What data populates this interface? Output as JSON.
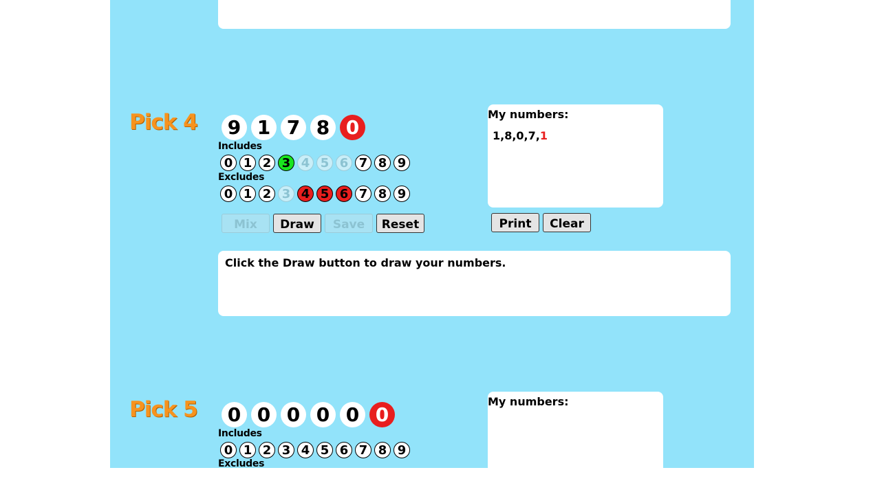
{
  "pick4": {
    "title": "Pick 4",
    "balls": [
      {
        "value": "9",
        "bonus": false
      },
      {
        "value": "1",
        "bonus": false
      },
      {
        "value": "7",
        "bonus": false
      },
      {
        "value": "8",
        "bonus": false
      },
      {
        "value": "0",
        "bonus": true
      }
    ],
    "includes_label": "Includes",
    "includes": [
      {
        "d": "0",
        "state": "normal"
      },
      {
        "d": "1",
        "state": "normal"
      },
      {
        "d": "2",
        "state": "normal"
      },
      {
        "d": "3",
        "state": "green"
      },
      {
        "d": "4",
        "state": "disabled"
      },
      {
        "d": "5",
        "state": "disabled"
      },
      {
        "d": "6",
        "state": "disabled"
      },
      {
        "d": "7",
        "state": "normal"
      },
      {
        "d": "8",
        "state": "normal"
      },
      {
        "d": "9",
        "state": "normal"
      }
    ],
    "excludes_label": "Excludes",
    "excludes": [
      {
        "d": "0",
        "state": "normal"
      },
      {
        "d": "1",
        "state": "normal"
      },
      {
        "d": "2",
        "state": "normal"
      },
      {
        "d": "3",
        "state": "disabled"
      },
      {
        "d": "4",
        "state": "red"
      },
      {
        "d": "5",
        "state": "red"
      },
      {
        "d": "6",
        "state": "red"
      },
      {
        "d": "7",
        "state": "normal"
      },
      {
        "d": "8",
        "state": "normal"
      },
      {
        "d": "9",
        "state": "normal"
      }
    ],
    "buttons": {
      "mix": "Mix",
      "draw": "Draw",
      "save": "Save",
      "reset": "Reset"
    },
    "my_numbers_label": "My numbers:",
    "my_numbers_prefix": "1,8,0,7,",
    "my_numbers_highlight": "1",
    "print_label": "Print",
    "clear_label": "Clear",
    "message": "Click the Draw button to draw your numbers."
  },
  "pick5": {
    "title": "Pick 5",
    "balls": [
      {
        "value": "0",
        "bonus": false
      },
      {
        "value": "0",
        "bonus": false
      },
      {
        "value": "0",
        "bonus": false
      },
      {
        "value": "0",
        "bonus": false
      },
      {
        "value": "0",
        "bonus": false
      },
      {
        "value": "0",
        "bonus": true
      }
    ],
    "includes_label": "Includes",
    "includes": [
      {
        "d": "0",
        "state": "normal"
      },
      {
        "d": "1",
        "state": "normal"
      },
      {
        "d": "2",
        "state": "normal"
      },
      {
        "d": "3",
        "state": "normal"
      },
      {
        "d": "4",
        "state": "normal"
      },
      {
        "d": "5",
        "state": "normal"
      },
      {
        "d": "6",
        "state": "normal"
      },
      {
        "d": "7",
        "state": "normal"
      },
      {
        "d": "8",
        "state": "normal"
      },
      {
        "d": "9",
        "state": "normal"
      }
    ],
    "excludes_label": "Excludes",
    "my_numbers_label": "My numbers:"
  },
  "colors": {
    "panel": "#92e3fa",
    "title": "#f7931e",
    "bonus": "#e81e1e",
    "include_active": "#19e61e",
    "exclude_active": "#e81e1e"
  }
}
